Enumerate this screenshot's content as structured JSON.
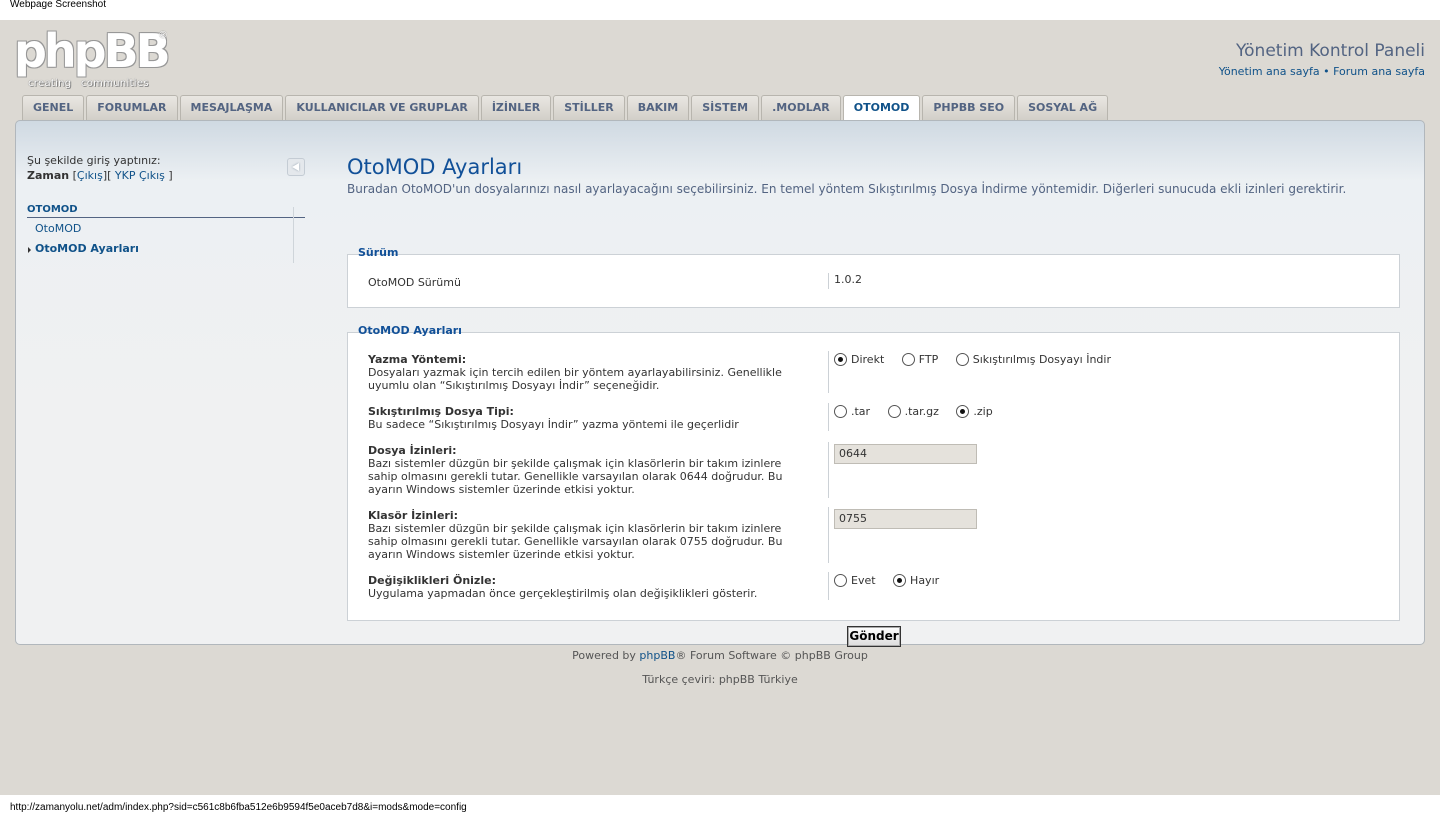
{
  "screenshot_label": "Webpage Screenshot",
  "status_bar_url": "http://zamanyolu.net/adm/index.php?sid=c561c8b6fba512e6b9594f5e0aceb7d8&i=mods&mode=config",
  "logo": {
    "text": "phpBB",
    "reg": "®",
    "tagline": "creating communities"
  },
  "header": {
    "title": "Yönetim Kontrol Paneli",
    "link_home": "Yönetim ana sayfa",
    "separator": "•",
    "link_forum": "Forum ana sayfa"
  },
  "tabs": [
    "GENEL",
    "FORUMLAR",
    "MESAJLAŞMA",
    "KULLANICILAR VE GRUPLAR",
    "İZİNLER",
    "STİLLER",
    "BAKIM",
    "SİSTEM",
    ".MODLAR",
    "OTOMOD",
    "PHPBB SEO",
    "SOSYAL AĞ"
  ],
  "active_tab": "OTOMOD",
  "sidebar": {
    "logged_in_label": "Şu şekilde giriş yaptınız:",
    "username": "Zaman",
    "logout_bracket_open": "[",
    "logout": "Çıkış",
    "bracket_mid": "][",
    "acp_logout": "YKP Çıkış",
    "bracket_close": "]",
    "section": "OTOMOD",
    "items": [
      "OtoMOD",
      "OtoMOD Ayarları"
    ]
  },
  "main": {
    "title": "OtoMOD Ayarları",
    "description": "Buradan OtoMOD'un dosyalarınızı nasıl ayarlayacağını seçebilirsiniz. En temel yöntem Sıkıştırılmış Dosya İndirme yöntemidir. Diğerleri sunucuda ekli izinleri gerektirir.",
    "version_legend": "Sürüm",
    "version_label": "OtoMOD Sürümü",
    "version_value": "1.0.2",
    "settings_legend": "OtoMOD Ayarları",
    "write_method": {
      "title": "Yazma Yöntemi:",
      "explain": "Dosyaları yazmak için tercih edilen bir yöntem ayarlayabilirsiniz. Genellikle uyumlu olan “Sıkıştırılmış Dosyayı İndir” seçeneğidir.",
      "options": [
        "Direkt",
        "FTP",
        "Sıkıştırılmış Dosyayı İndir"
      ],
      "selected": "Direkt"
    },
    "compress_type": {
      "title": "Sıkıştırılmış Dosya Tipi:",
      "explain": "Bu sadece “Sıkıştırılmış Dosyayı İndir” yazma yöntemi ile geçerlidir",
      "options": [
        ".tar",
        ".tar.gz",
        ".zip"
      ],
      "selected": ".zip"
    },
    "file_perms": {
      "title": "Dosya İzinleri:",
      "explain": "Bazı sistemler düzgün bir şekilde çalışmak için klasörlerin bir takım izinlere sahip olmasını gerekli tutar. Genellikle varsayılan olarak 0644 doğrudur. Bu ayarın Windows sistemler üzerinde etkisi yoktur.",
      "value": "0644"
    },
    "dir_perms": {
      "title": "Klasör İzinleri:",
      "explain": "Bazı sistemler düzgün bir şekilde çalışmak için klasörlerin bir takım izinlere sahip olmasını gerekli tutar. Genellikle varsayılan olarak 0755 doğrudur. Bu ayarın Windows sistemler üzerinde etkisi yoktur.",
      "value": "0755"
    },
    "preview": {
      "title": "Değişiklikleri Önizle:",
      "explain": "Uygulama yapmadan önce gerçekleştirilmiş olan değişiklikleri gösterir.",
      "options": [
        "Evet",
        "Hayır"
      ],
      "selected": "Hayır"
    },
    "submit": "Gönder"
  },
  "footer": {
    "powered_prefix": "Powered by",
    "powered_link": "phpBB",
    "powered_suffix": "® Forum Software © phpBB Group",
    "translation_prefix": "Türkçe çeviri:",
    "translation_link": "phpBB Türkiye"
  }
}
